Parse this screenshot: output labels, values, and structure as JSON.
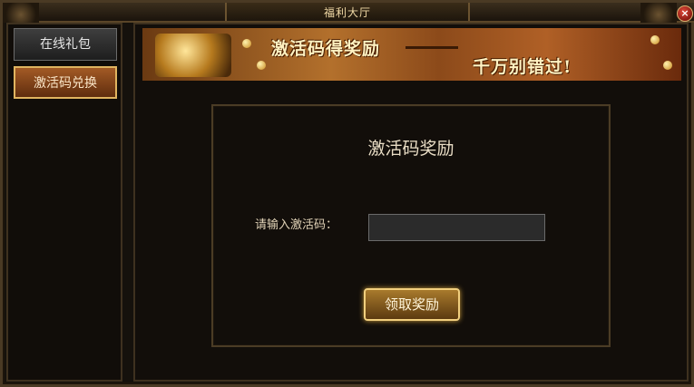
{
  "window": {
    "title": "福利大厅",
    "close_glyph": "×"
  },
  "sidebar": {
    "items": [
      {
        "label": "在线礼包",
        "active": false
      },
      {
        "label": "激活码兑换",
        "active": true
      }
    ]
  },
  "banner": {
    "headline": "激活码得奖励",
    "tagline": "千万别错过!"
  },
  "panel": {
    "title": "激活码奖励",
    "input_label": "请输入激活码：",
    "input_value": "",
    "input_placeholder": "",
    "claim_label": "领取奖励"
  },
  "colors": {
    "accent_gold": "#e0b460",
    "active_tab": "#a35a25",
    "frame": "#4a3a24"
  },
  "icons": {
    "close": "close-icon",
    "banner_art": "treasure-chest-icon"
  }
}
